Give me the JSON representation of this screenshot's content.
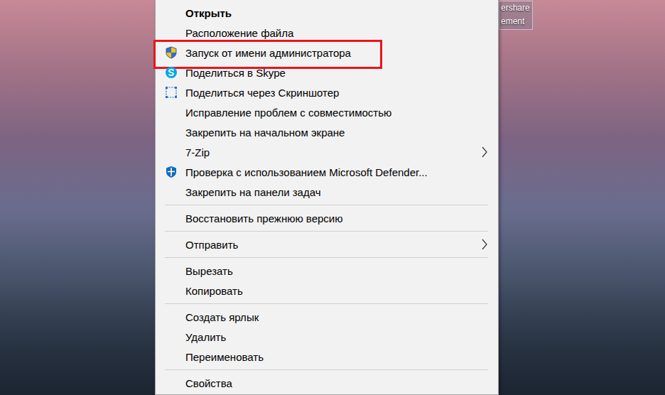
{
  "desktop": {
    "icon_label": {
      "lines": [
        "ershare",
        "ement"
      ],
      "selected": true
    }
  },
  "context_menu": {
    "items": [
      {
        "kind": "default",
        "label": "Открыть",
        "highlighted": false
      },
      {
        "kind": "plain",
        "label": "Расположение файла",
        "highlighted": false
      },
      {
        "kind": "uac",
        "label": "Запуск от имени администратора",
        "highlighted": true
      },
      {
        "kind": "skype",
        "label": "Поделиться в Skype",
        "highlighted": false
      },
      {
        "kind": "screenshot",
        "label": "Поделиться через Скриншотер",
        "highlighted": false
      },
      {
        "kind": "plain",
        "label": "Исправление проблем с совместимостью",
        "highlighted": false
      },
      {
        "kind": "plain",
        "label": "Закрепить на начальном экране",
        "highlighted": false
      },
      {
        "kind": "submenu",
        "label": "7-Zip",
        "highlighted": false
      },
      {
        "kind": "defender",
        "label": "Проверка с использованием Microsoft Defender...",
        "highlighted": false
      },
      {
        "kind": "plain",
        "label": "Закрепить на панели задач",
        "highlighted": false
      },
      {
        "kind": "separator",
        "label": "",
        "highlighted": false
      },
      {
        "kind": "plain",
        "label": "Восстановить прежнюю версию",
        "highlighted": false
      },
      {
        "kind": "separator",
        "label": "",
        "highlighted": false
      },
      {
        "kind": "submenu",
        "label": "Отправить",
        "highlighted": false
      },
      {
        "kind": "separator",
        "label": "",
        "highlighted": false
      },
      {
        "kind": "plain",
        "label": "Вырезать",
        "highlighted": false
      },
      {
        "kind": "plain",
        "label": "Копировать",
        "highlighted": false
      },
      {
        "kind": "separator",
        "label": "",
        "highlighted": false
      },
      {
        "kind": "plain",
        "label": "Создать ярлык",
        "highlighted": false
      },
      {
        "kind": "plain",
        "label": "Удалить",
        "highlighted": false
      },
      {
        "kind": "plain",
        "label": "Переименовать",
        "highlighted": false
      },
      {
        "kind": "separator",
        "label": "",
        "highlighted": false
      },
      {
        "kind": "plain",
        "label": "Свойства",
        "highlighted": false
      }
    ]
  }
}
